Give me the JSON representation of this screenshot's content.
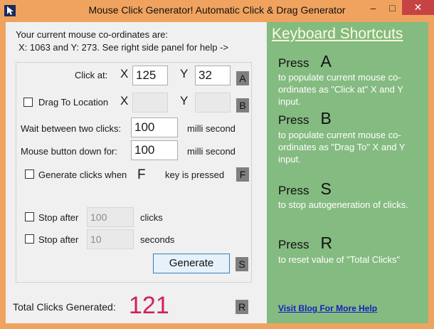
{
  "window": {
    "title": "Mouse Click Generator! Automatic Click & Drag Generator",
    "minimize_label": "–",
    "maximize_label": "□",
    "close_label": "✕"
  },
  "coords": {
    "line1": "Your current mouse co-ordinates are:",
    "line2": "X: 1063 and Y: 273. See right side panel for help ->"
  },
  "click_at": {
    "label": "Click at:",
    "x_label": "X",
    "x_value": "125",
    "y_label": "Y",
    "y_value": "32",
    "key": "A"
  },
  "drag_to": {
    "label": "Drag To Location",
    "x_label": "X",
    "x_value": "",
    "y_label": "Y",
    "y_value": "",
    "key": "B"
  },
  "wait": {
    "label": "Wait between two clicks:",
    "value": "100",
    "unit": "milli second"
  },
  "button_down": {
    "label": "Mouse button down for:",
    "value": "100",
    "unit": "milli second"
  },
  "generate_when": {
    "label": "Generate clicks when",
    "key_char": "F",
    "suffix": "key is pressed",
    "key": "F"
  },
  "stop_clicks": {
    "label": "Stop after",
    "value": "100",
    "unit": "clicks"
  },
  "stop_seconds": {
    "label": "Stop after",
    "value": "10",
    "unit": "seconds"
  },
  "generate": {
    "label": "Generate",
    "key": "S"
  },
  "total": {
    "label": "Total Clicks Generated:",
    "value": "121",
    "key": "R"
  },
  "shortcuts": {
    "title": "Keyboard Shortcuts",
    "items": [
      {
        "press": "Press",
        "key": "A",
        "desc": "to populate current mouse co-ordinates as \"Click at\" X and Y input."
      },
      {
        "press": "Press",
        "key": "B",
        "desc": "to populate current mouse co-ordinates as \"Drag To\" X and Y input."
      },
      {
        "press": "Press",
        "key": "S",
        "desc": "to stop autogeneration of clicks."
      },
      {
        "press": "Press",
        "key": "R",
        "desc": "to reset value of \"Total Clicks\""
      }
    ],
    "blog_link": "Visit Blog For More Help"
  },
  "colors": {
    "title_bar": "#f0a35e",
    "shortcut_panel": "#84bb80",
    "total_number": "#d0205a",
    "close_button": "#c74343"
  }
}
